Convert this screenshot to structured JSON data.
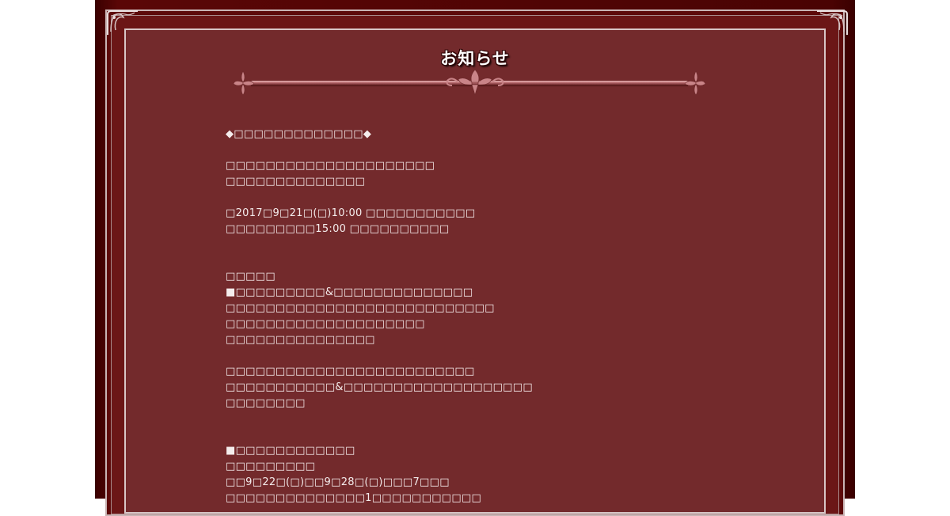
{
  "page": {
    "title": "お知らせ",
    "colors": {
      "outer_frame": "#4a0303",
      "panel_background": "#732a2c",
      "panel_border": "#d8c6c6",
      "ornament": "#c98488",
      "text": "#f4ecec"
    }
  },
  "notice": {
    "lines": [
      "◆□□□□□□□□□□□□□◆",
      "",
      "□□□□□□□□□□□□□□□□□□□□□",
      "□□□□□□□□□□□□□□",
      "",
      "□2017□9□21□(□)10:00 □□□□□□□□□□□",
      "□□□□□□□□□15:00 □□□□□□□□□□",
      "",
      "",
      "□□□□□",
      "■□□□□□□□□□&□□□□□□□□□□□□□□",
      "□□□□□□□□□□□□□□□□□□□□□□□□□□□",
      "□□□□□□□□□□□□□□□□□□□□",
      "□□□□□□□□□□□□□□□",
      "",
      "□□□□□□□□□□□□□□□□□□□□□□□□□",
      "□□□□□□□□□□□&□□□□□□□□□□□□□□□□□□□",
      "□□□□□□□□",
      "",
      "",
      "■□□□□□□□□□□□□",
      "□□□□□□□□□",
      "□□9□22□(□)□□9□28□(□)□□□7□□□",
      "□□□□□□□□□□□□□□1□□□□□□□□□□□"
    ]
  }
}
